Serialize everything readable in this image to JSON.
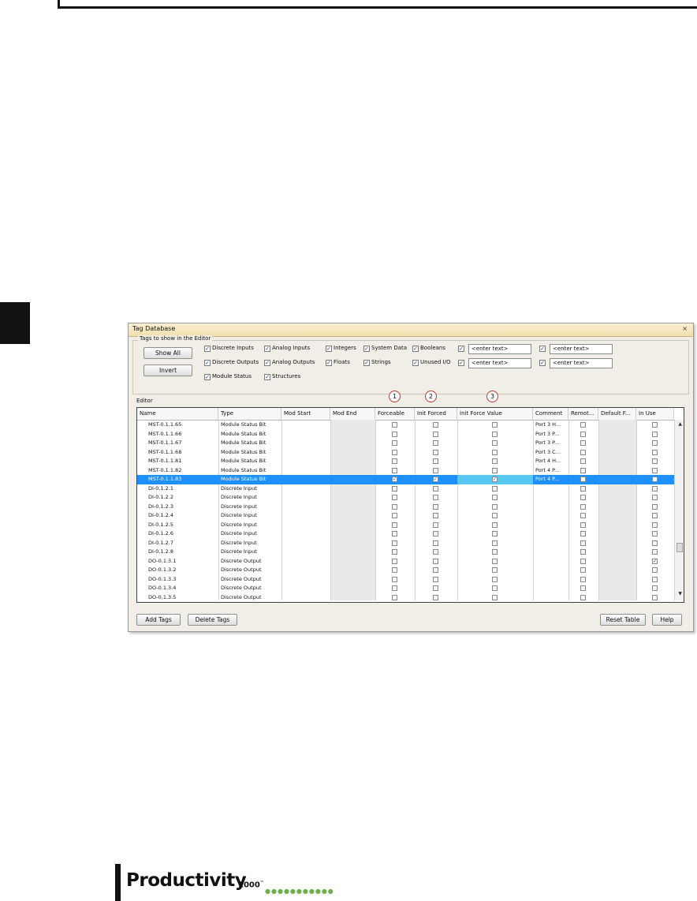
{
  "window": {
    "title": "Tag Database",
    "close": "×"
  },
  "filters": {
    "legend": "Tags to show in the Editor",
    "show_all": "Show All",
    "invert": "Invert",
    "options": [
      {
        "label": "Discrete Inputs",
        "checked": true
      },
      {
        "label": "Analog Inputs",
        "checked": true
      },
      {
        "label": "Integers",
        "checked": true
      },
      {
        "label": "System Data",
        "checked": true
      },
      {
        "label": "Booleans",
        "checked": true
      },
      {
        "label": "Discrete Outputs",
        "checked": true
      },
      {
        "label": "Analog Outputs",
        "checked": true
      },
      {
        "label": "Floats",
        "checked": true
      },
      {
        "label": "Strings",
        "checked": true
      },
      {
        "label": "Unused I/O",
        "checked": true
      },
      {
        "label": "Module Status",
        "checked": true
      },
      {
        "label": "Structures",
        "checked": true
      }
    ],
    "text_filters": [
      "<enter text>",
      "<enter text>",
      "<enter text>",
      "<enter text>"
    ]
  },
  "editor": {
    "label": "Editor",
    "columns": [
      "Name",
      "Type",
      "Mod Start",
      "Mod End",
      "Forceable",
      "Init Forced",
      "Init Force Value",
      "Comment",
      "Remot...",
      "Default F...",
      "In Use"
    ],
    "rows": [
      {
        "name": "MST-0.1.1.65",
        "type": "Module Status Bit",
        "comment": "Port 3 H...",
        "forceable": false,
        "init_forced": false,
        "init_force_value": false,
        "in_use": false,
        "selected": false
      },
      {
        "name": "MST-0.1.1.66",
        "type": "Module Status Bit",
        "comment": "Port 3 P...",
        "forceable": false,
        "init_forced": false,
        "init_force_value": false,
        "in_use": false,
        "selected": false
      },
      {
        "name": "MST-0.1.1.67",
        "type": "Module Status Bit",
        "comment": "Port 3 P...",
        "forceable": false,
        "init_forced": false,
        "init_force_value": false,
        "in_use": false,
        "selected": false
      },
      {
        "name": "MST-0.1.1.68",
        "type": "Module Status Bit",
        "comment": "Port 3 C...",
        "forceable": false,
        "init_forced": false,
        "init_force_value": false,
        "in_use": false,
        "selected": false
      },
      {
        "name": "MST-0.1.1.81",
        "type": "Module Status Bit",
        "comment": "Port 4 H...",
        "forceable": false,
        "init_forced": false,
        "init_force_value": false,
        "in_use": false,
        "selected": false
      },
      {
        "name": "MST-0.1.1.82",
        "type": "Module Status Bit",
        "comment": "Port 4 P...",
        "forceable": false,
        "init_forced": false,
        "init_force_value": false,
        "in_use": false,
        "selected": false
      },
      {
        "name": "MST-0.1.1.83",
        "type": "Module Status Bit",
        "comment": "Port 4 P...",
        "forceable": true,
        "init_forced": true,
        "init_force_value": true,
        "in_use": false,
        "selected": true
      },
      {
        "name": "DI-0.1.2.1",
        "type": "Discrete Input",
        "comment": "",
        "forceable": false,
        "init_forced": false,
        "init_force_value": false,
        "in_use": false,
        "selected": false
      },
      {
        "name": "DI-0.1.2.2",
        "type": "Discrete Input",
        "comment": "",
        "forceable": false,
        "init_forced": false,
        "init_force_value": false,
        "in_use": false,
        "selected": false
      },
      {
        "name": "DI-0.1.2.3",
        "type": "Discrete Input",
        "comment": "",
        "forceable": false,
        "init_forced": false,
        "init_force_value": false,
        "in_use": false,
        "selected": false
      },
      {
        "name": "DI-0.1.2.4",
        "type": "Discrete Input",
        "comment": "",
        "forceable": false,
        "init_forced": false,
        "init_force_value": false,
        "in_use": false,
        "selected": false
      },
      {
        "name": "DI-0.1.2.5",
        "type": "Discrete Input",
        "comment": "",
        "forceable": false,
        "init_forced": false,
        "init_force_value": false,
        "in_use": false,
        "selected": false
      },
      {
        "name": "DI-0.1.2.6",
        "type": "Discrete Input",
        "comment": "",
        "forceable": false,
        "init_forced": false,
        "init_force_value": false,
        "in_use": false,
        "selected": false
      },
      {
        "name": "DI-0.1.2.7",
        "type": "Discrete Input",
        "comment": "",
        "forceable": false,
        "init_forced": false,
        "init_force_value": false,
        "in_use": false,
        "selected": false
      },
      {
        "name": "DI-0.1.2.8",
        "type": "Discrete Input",
        "comment": "",
        "forceable": false,
        "init_forced": false,
        "init_force_value": false,
        "in_use": false,
        "selected": false
      },
      {
        "name": "DO-0.1.3.1",
        "type": "Discrete Output",
        "comment": "",
        "forceable": false,
        "init_forced": false,
        "init_force_value": false,
        "in_use": true,
        "selected": false
      },
      {
        "name": "DO-0.1.3.2",
        "type": "Discrete Output",
        "comment": "",
        "forceable": false,
        "init_forced": false,
        "init_force_value": false,
        "in_use": false,
        "selected": false
      },
      {
        "name": "DO-0.1.3.3",
        "type": "Discrete Output",
        "comment": "",
        "forceable": false,
        "init_forced": false,
        "init_force_value": false,
        "in_use": false,
        "selected": false
      },
      {
        "name": "DO-0.1.3.4",
        "type": "Discrete Output",
        "comment": "",
        "forceable": false,
        "init_forced": false,
        "init_force_value": false,
        "in_use": false,
        "selected": false
      },
      {
        "name": "DO-0.1.3.5",
        "type": "Discrete Output",
        "comment": "",
        "forceable": false,
        "init_forced": false,
        "init_force_value": false,
        "in_use": false,
        "selected": false
      }
    ]
  },
  "callouts": [
    "1",
    "2",
    "3"
  ],
  "buttons": {
    "add_tags": "Add Tags",
    "delete_tags": "Delete Tags",
    "reset_table": "Reset Table",
    "help": "Help"
  },
  "icons": {
    "scroll_up": "scroll-up-icon",
    "scroll_down": "scroll-down-icon",
    "check": "check-icon"
  },
  "colors": {
    "selection": "#1e90ff",
    "highlight": "#57c8f2",
    "titlebar": "#f1dfac",
    "logo_dots": "#6ab04c"
  },
  "logo": {
    "word": "Productivity",
    "number": "1000",
    "tm": "™"
  }
}
